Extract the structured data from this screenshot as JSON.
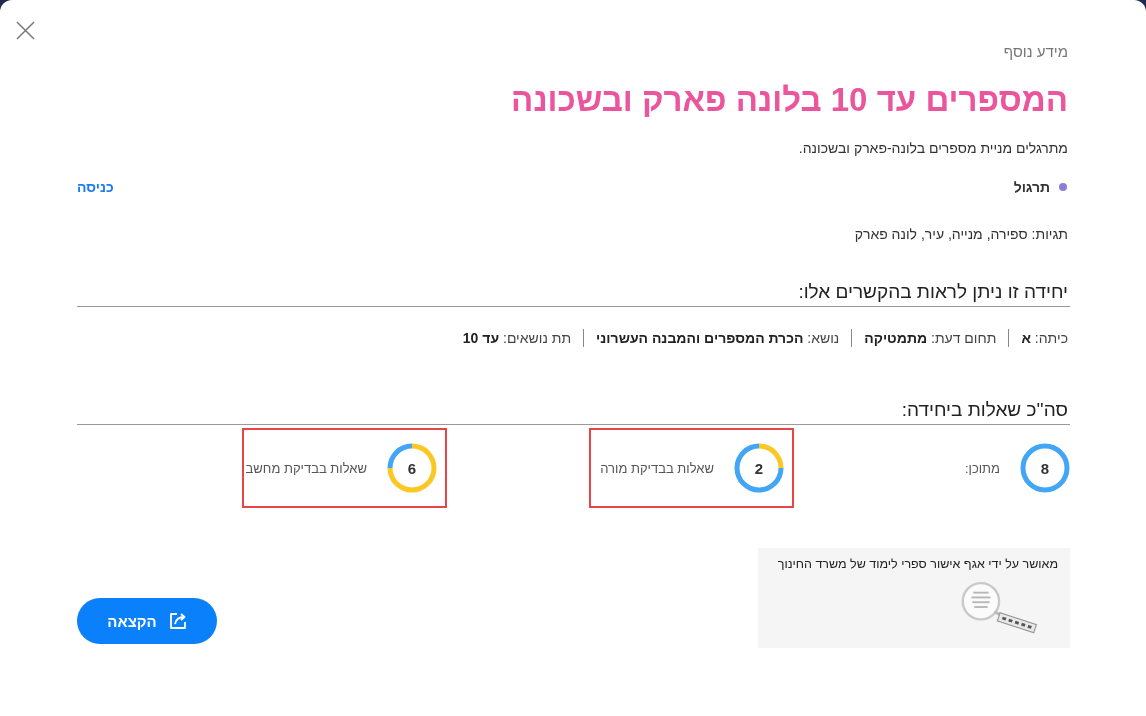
{
  "overline": "מידע נוסף",
  "title": "המספרים עד 10 בלונה פארק ובשכונה",
  "description": "מתרגלים מניית מספרים בלונה-פארק ובשכונה.",
  "unit_type": "תרגול",
  "enter_link": "כניסה",
  "tags": "תגיות: ספירה, מנייה, עיר, לונה פארק",
  "contexts": {
    "heading": "יחידה זו ניתן לראות בהקשרים אלו:",
    "items": [
      "כיתה: **א**",
      "תחום דעת: **מתמטיקה**",
      "נושא: **הכרת המספרים והמבנה העשרוני**",
      "תת נושאים: **עד 10**"
    ]
  },
  "questions": {
    "heading": "סה''כ שאלות ביחידה:",
    "stats": [
      {
        "count": "8",
        "label": "מתוכן:",
        "highlighted": false
      },
      {
        "count": "2",
        "label": "שאלות בבדיקת מורה",
        "highlighted": true,
        "chart_data": {
          "type": "donut",
          "values": [
            25,
            75
          ]
        }
      },
      {
        "count": "6",
        "label": "שאלות בבדיקת מחשב",
        "highlighted": true,
        "chart_data": {
          "type": "donut",
          "values": [
            75,
            25
          ]
        }
      }
    ]
  },
  "approval": "מאושר על ידי אגף אישור ספרי לימוד של משרד החינוך",
  "assign_button": "הקצאה"
}
